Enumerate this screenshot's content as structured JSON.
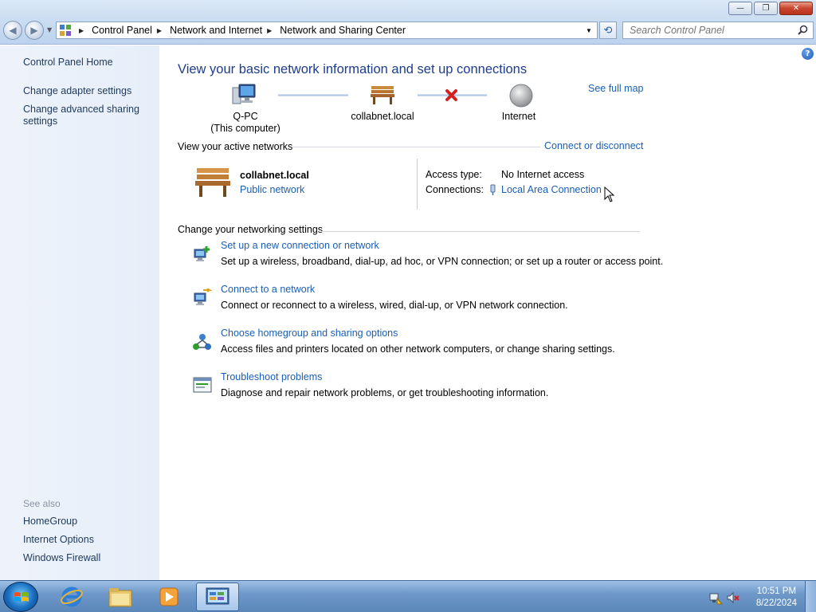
{
  "window": {
    "buttons": {
      "minimize": "—",
      "maximize": "❐",
      "close": "✕"
    }
  },
  "address_bar": {
    "crumbs": [
      "Control Panel",
      "Network and Internet",
      "Network and Sharing Center"
    ]
  },
  "search": {
    "placeholder": "Search Control Panel"
  },
  "left_pane": {
    "links": [
      "Control Panel Home",
      "Change adapter settings",
      "Change advanced sharing",
      "settings"
    ],
    "see_also_label": "See also",
    "see_also": [
      "HomeGroup",
      "Internet Options",
      "Windows Firewall"
    ]
  },
  "main": {
    "title": "View your basic network information and set up connections",
    "see_full_map": "See full map",
    "map": {
      "computer_name": "Q-PC",
      "computer_sub": "(This computer)",
      "network_name": "collabnet.local",
      "internet": "Internet"
    },
    "active_networks": {
      "header": "View your active networks",
      "connect_link": "Connect or disconnect",
      "network_name": "collabnet.local",
      "network_type": "Public network",
      "access_type_label": "Access type:",
      "access_type_value": "No Internet access",
      "connections_label": "Connections:",
      "connections_value": "Local Area Connection"
    },
    "settings": {
      "header": "Change your networking settings",
      "tasks": [
        {
          "link": "Set up a new connection or network",
          "desc": "Set up a wireless, broadband, dial-up, ad hoc, or VPN connection; or set up a router or access point."
        },
        {
          "link": "Connect to a network",
          "desc": "Connect or reconnect to a wireless, wired, dial-up, or VPN network connection."
        },
        {
          "link": "Choose homegroup and sharing options",
          "desc": "Access files and printers located on other network computers, or change sharing settings."
        },
        {
          "link": "Troubleshoot problems",
          "desc": "Diagnose and repair network problems, or get troubleshooting information."
        }
      ]
    }
  },
  "taskbar": {
    "time": "10:51 PM",
    "date": "8/22/2024"
  },
  "colors": {
    "link": "#1a5fb4",
    "title": "#1e3c8c",
    "left_pane_link": "#1e395b",
    "error_x": "#d42020"
  }
}
